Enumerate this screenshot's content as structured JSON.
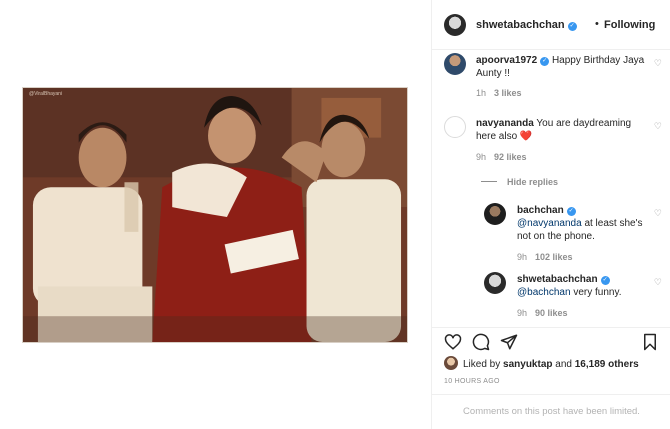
{
  "photo": {
    "watermark": "@ViralBhayani"
  },
  "header": {
    "username": "shwetabachchan",
    "separator": "•",
    "follow_label": "Following",
    "verified_icon": "✓"
  },
  "comments": [
    {
      "username": "apoorva1972",
      "text": "Happy Birthday Jaya Aunty !!",
      "time": "1h",
      "likes": "3 likes",
      "verified": true
    },
    {
      "username": "navyananda",
      "text": "You are daydreaming here also",
      "emoji": "❤️",
      "time": "9h",
      "likes": "92 likes"
    }
  ],
  "hide_replies_label": "Hide replies",
  "replies": [
    {
      "username": "bachchan",
      "mention": "@navyananda",
      "text": "at least she's not on the phone.",
      "time": "9h",
      "likes": "102 likes",
      "verified": true
    },
    {
      "username": "shwetabachchan",
      "mention": "@bachchan",
      "text": "very funny.",
      "time": "9h",
      "likes": "90 likes",
      "verified": true
    }
  ],
  "likes_line": {
    "prefix": "Liked by",
    "user": "sanyuktap",
    "middle": "and",
    "count": "16,189 others"
  },
  "timestamp": "10 HOURS AGO",
  "comments_limited": "Comments on this post have been limited.",
  "colors": {
    "accent": "#3897f0",
    "heart": "#ed4956",
    "muted": "#8e8e8e"
  }
}
